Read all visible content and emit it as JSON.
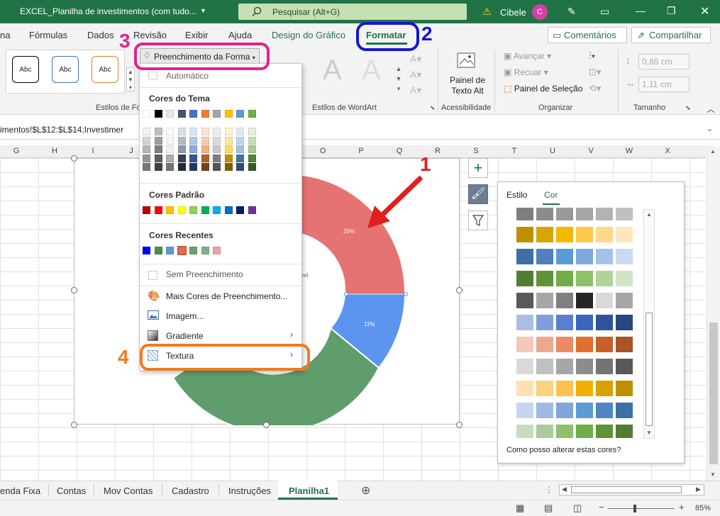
{
  "titlebar": {
    "title": "EXCEL_Planilha de investimentos (com tudo...",
    "search_placeholder": "Pesquisar (Alt+G)",
    "user": "Cibele",
    "avatar": "C"
  },
  "tabs": [
    "na",
    "Fórmulas",
    "Dados",
    "Revisão",
    "Exibir",
    "Ajuda",
    "Design do Gráfico",
    "Formatar"
  ],
  "share": {
    "comments": "Comentários",
    "share": "Compartilhar"
  },
  "ribbon": {
    "shape_styles": [
      "Abc",
      "Abc",
      "Abc"
    ],
    "fill_button": "Preenchimento da Forma",
    "group_shape_styles": "Estilos de Fo",
    "group_wordart": "Estilos de WordArt",
    "alt_text": [
      "Painel de",
      "Texto Alt"
    ],
    "group_accessibility": "Acessibilidade",
    "arrange": {
      "forward": "Avançar",
      "backward": "Recuar",
      "selection_pane": "Painel de Seleção"
    },
    "group_arrange": "Organizar",
    "size": {
      "height": "0,88 cm",
      "width": "1,11 cm"
    },
    "group_size": "Tamanho"
  },
  "formula_bar": "imentos!$L$12:$L$14;Investimer",
  "columns": [
    "G",
    "H",
    "I",
    "J",
    "O",
    "P",
    "Q",
    "R",
    "S",
    "T",
    "U",
    "V",
    "W",
    "X"
  ],
  "chart": {
    "labels": [
      "25%",
      "11%",
      "vel"
    ]
  },
  "menu": {
    "automatic": "Automático",
    "theme_colors": "Cores do Tema",
    "standard_colors": "Cores Padrão",
    "recent_colors": "Cores Recentes",
    "no_fill": "Sem Preenchimento",
    "more_colors": "Mais Cores de Preenchimento...",
    "picture": "Imagem...",
    "gradient": "Gradiente",
    "texture": "Textura",
    "theme_top": [
      "#ffffff",
      "#000000",
      "#e7e6e6",
      "#44546a",
      "#4472c4",
      "#ed7d31",
      "#a5a5a5",
      "#ffc000",
      "#5b9bd5",
      "#70ad47"
    ],
    "standard": [
      "#c00000",
      "#ff0000",
      "#ffc000",
      "#ffff00",
      "#92d050",
      "#00b050",
      "#00b0f0",
      "#0070c0",
      "#002060",
      "#7030a0"
    ],
    "recent": [
      "#0000ff",
      "#4a8f4a",
      "#5b9bd5",
      "#e06a5a",
      "#6aa06a",
      "#7fae8c",
      "#f0a0a0"
    ]
  },
  "panel": {
    "tab_style": "Estilo",
    "tab_color": "Cor",
    "help": "Como posso alterar estas cores?"
  },
  "sheet_tabs": [
    "enda Fixa",
    "Contas",
    "Mov Contas",
    "Cadastro",
    "Instruções",
    "Planilha1"
  ],
  "status": {
    "zoom": "85%"
  },
  "annotations": [
    "1",
    "2",
    "3",
    "4"
  ]
}
